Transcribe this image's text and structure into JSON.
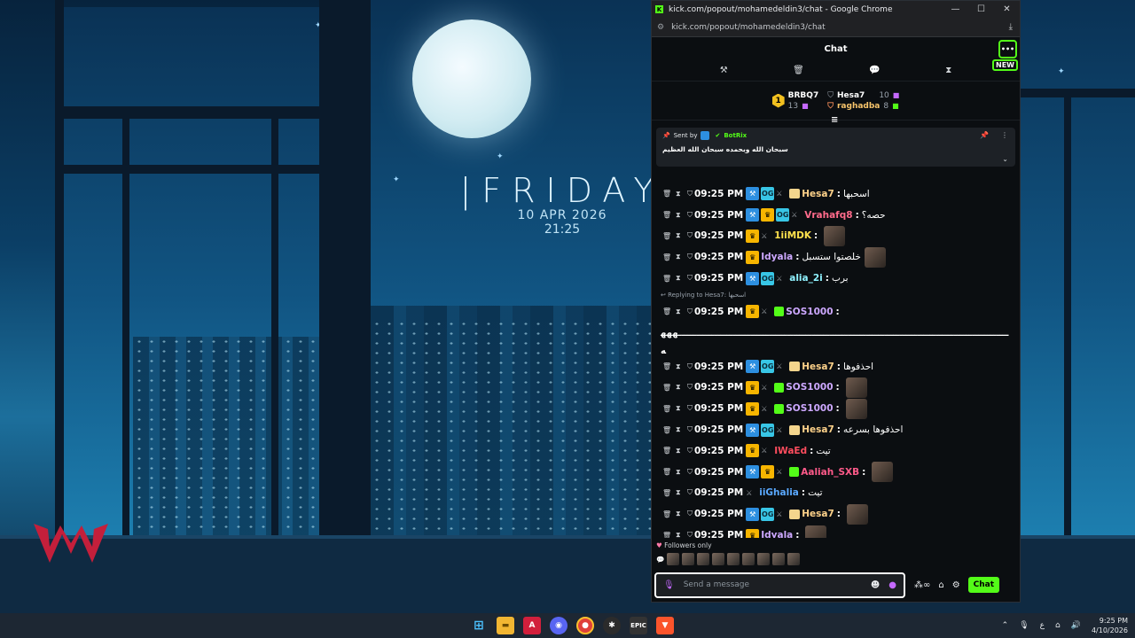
{
  "desktop": {
    "clock": {
      "day": "|FRIDAY",
      "date": "10 APR 2026",
      "time": "21:25"
    }
  },
  "browser": {
    "window_title": "kick.com/popout/mohamedeldin3/chat - Google Chrome",
    "url": "kick.com/popout/mohamedeldin3/chat"
  },
  "chat": {
    "header_title": "Chat",
    "more_icon": "more-horizontal-icon",
    "new_badge": "NEW",
    "leaderboard": {
      "rank": "1",
      "entries": [
        {
          "name": "BRBQ7",
          "value": "13"
        },
        {
          "name": "Hesa7",
          "value": "10"
        },
        {
          "name": "raghadba",
          "value": "8"
        }
      ]
    },
    "pinned": {
      "sent_by_label": "Sent by",
      "sender": "BotRix",
      "text": "سبحان الله وبحمده سبحان الله العظيم"
    },
    "messages": [
      {
        "time": "09:25 PM",
        "user": "Hesa7",
        "color": "#ffd28a",
        "text": "اسحبها",
        "badges": [
          "mod",
          "og",
          "sword",
          "subg"
        ],
        "emote": false
      },
      {
        "time": "09:25 PM",
        "user": "Vrahafq8",
        "color": "#ff6b8b",
        "text": "حصه؟",
        "badges": [
          "mod",
          "vip",
          "og",
          "sword"
        ],
        "emote": false
      },
      {
        "time": "09:25 PM",
        "user": "1iiMDK",
        "color": "#ffe14d",
        "text": "",
        "badges": [
          "vip",
          "sword"
        ],
        "emote": true
      },
      {
        "time": "09:25 PM",
        "user": "Idyala",
        "color": "#cda8ff",
        "text": "خلصتوا ستسبل",
        "badges": [
          "vip"
        ],
        "emote": true
      },
      {
        "time": "09:25 PM",
        "user": "alia_2i",
        "color": "#8ff2ff",
        "text": "برب",
        "badges": [
          "mod",
          "og",
          "sword"
        ],
        "emote": false
      }
    ],
    "reply_note": "Replying to Hesa7: اسحبها",
    "reply_message": {
      "time": "09:25 PM",
      "user": "SOS1000",
      "color": "#cda8ff",
      "badges": [
        "vip",
        "sword",
        "sub"
      ]
    },
    "long_text": "ـــــــــــــــــــــــــــــــــــــــــــــــــــــــــــــــــــــــــــــــــــــــــــــــــــــــــــــهههه",
    "messages2": [
      {
        "time": "09:25 PM",
        "user": "Hesa7",
        "color": "#ffd28a",
        "text": "احذفوها",
        "badges": [
          "mod",
          "og",
          "sword",
          "subg"
        ],
        "emote": false
      },
      {
        "time": "09:25 PM",
        "user": "SOS1000",
        "color": "#cda8ff",
        "text": "",
        "badges": [
          "vip",
          "sword",
          "sub"
        ],
        "emote": true
      },
      {
        "time": "09:25 PM",
        "user": "SOS1000",
        "color": "#cda8ff",
        "text": "",
        "badges": [
          "vip",
          "sword",
          "sub"
        ],
        "emote": true
      },
      {
        "time": "09:25 PM",
        "user": "Hesa7",
        "color": "#ffd28a",
        "text": "احذفوها بسرعه",
        "badges": [
          "mod",
          "og",
          "sword",
          "subg"
        ],
        "emote": false
      },
      {
        "time": "09:25 PM",
        "user": "IWaEd",
        "color": "#ff4d5e",
        "text": "تيت",
        "badges": [
          "vip",
          "sword"
        ],
        "emote": false
      },
      {
        "time": "09:25 PM",
        "user": "Aaliah_SXB",
        "color": "#ff5a8a",
        "text": "",
        "badges": [
          "mod",
          "vip",
          "sword",
          "sub"
        ],
        "emote": true
      },
      {
        "time": "09:25 PM",
        "user": "iiGhalia",
        "color": "#5aa9ff",
        "text": "تيت",
        "badges": [
          "sword"
        ],
        "emote": false
      },
      {
        "time": "09:25 PM",
        "user": "Hesa7",
        "color": "#ffd28a",
        "text": "",
        "badges": [
          "mod",
          "og",
          "sword",
          "subg"
        ],
        "emote": true
      },
      {
        "time": "09:25 PM",
        "user": "Idyala",
        "color": "#cda8ff",
        "text": "",
        "badges": [
          "vip"
        ],
        "emote": true
      }
    ],
    "followers_only": "Followers only",
    "input": {
      "placeholder": "Send a message",
      "value": ""
    },
    "send_label": "Chat"
  },
  "taskbar": {
    "tray_lang": "ع",
    "tray_time": "9:25 PM",
    "tray_date": "4/10/2026"
  }
}
